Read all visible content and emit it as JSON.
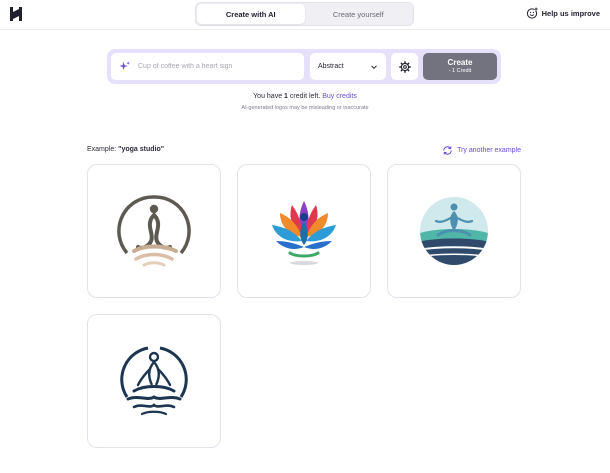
{
  "header": {
    "logo_icon": "h-logo-icon",
    "tabs": [
      {
        "label": "Create with AI",
        "active": true
      },
      {
        "label": "Create yourself",
        "active": false
      }
    ],
    "help_label": "Help us improve",
    "help_icon": "smiley-plus-icon"
  },
  "prompt": {
    "placeholder": "Cup of coffee with a heart sign",
    "value": "",
    "style_value": "Abstract",
    "create_label": "Create",
    "create_cost": "- 1 Credit",
    "accent": "#e6e0fb",
    "button_color": "#737380"
  },
  "credits": {
    "prefix": "You have",
    "count": "1",
    "suffix": "credit left.",
    "buy_label": "Buy credits",
    "disclaimer": "AI-generated logos may be misleading or inaccurate"
  },
  "example": {
    "prefix": "Example:",
    "query": "\"yoga studio\"",
    "try_another": "Try another example",
    "link_color": "#6b4cd6",
    "logos": [
      {
        "icon": "yoga-circle-earth-logo"
      },
      {
        "icon": "yoga-lotus-colorful-logo"
      },
      {
        "icon": "yoga-meditation-waves-logo"
      },
      {
        "icon": "yoga-meditation-navy-logo"
      }
    ]
  }
}
